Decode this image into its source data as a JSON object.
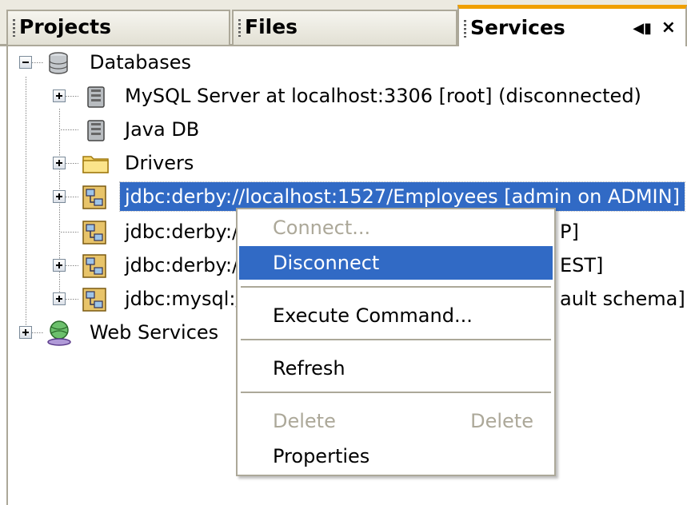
{
  "tabs": {
    "projects": "Projects",
    "files": "Files",
    "services": "Services"
  },
  "tree": {
    "databases": "Databases",
    "mysql_server": "MySQL Server at localhost:3306 [root] (disconnected)",
    "java_db": "Java DB",
    "drivers": "Drivers",
    "conn1": "jdbc:derby://localhost:1527/Employees [admin on ADMIN]",
    "conn2_left": "jdbc:derby:/",
    "conn2_right": "P]",
    "conn3_left": "jdbc:derby:/",
    "conn3_right": "EST]",
    "conn4_left": "jdbc:mysql:/",
    "conn4_right": "ault schema]",
    "web_services": "Web Services"
  },
  "menu": {
    "connect": "Connect...",
    "disconnect": "Disconnect",
    "execute": "Execute Command...",
    "refresh": "Refresh",
    "delete": "Delete",
    "delete_shortcut": "Delete",
    "properties": "Properties"
  },
  "colors": {
    "selection": "#316ac5",
    "disabled_text": "#aca899",
    "active_tab_accent": "#f0a000"
  },
  "icons": {
    "database": "database-icon",
    "server": "server-icon",
    "folder": "folder-icon",
    "connection": "connection-icon",
    "web_services": "web-services-icon"
  }
}
